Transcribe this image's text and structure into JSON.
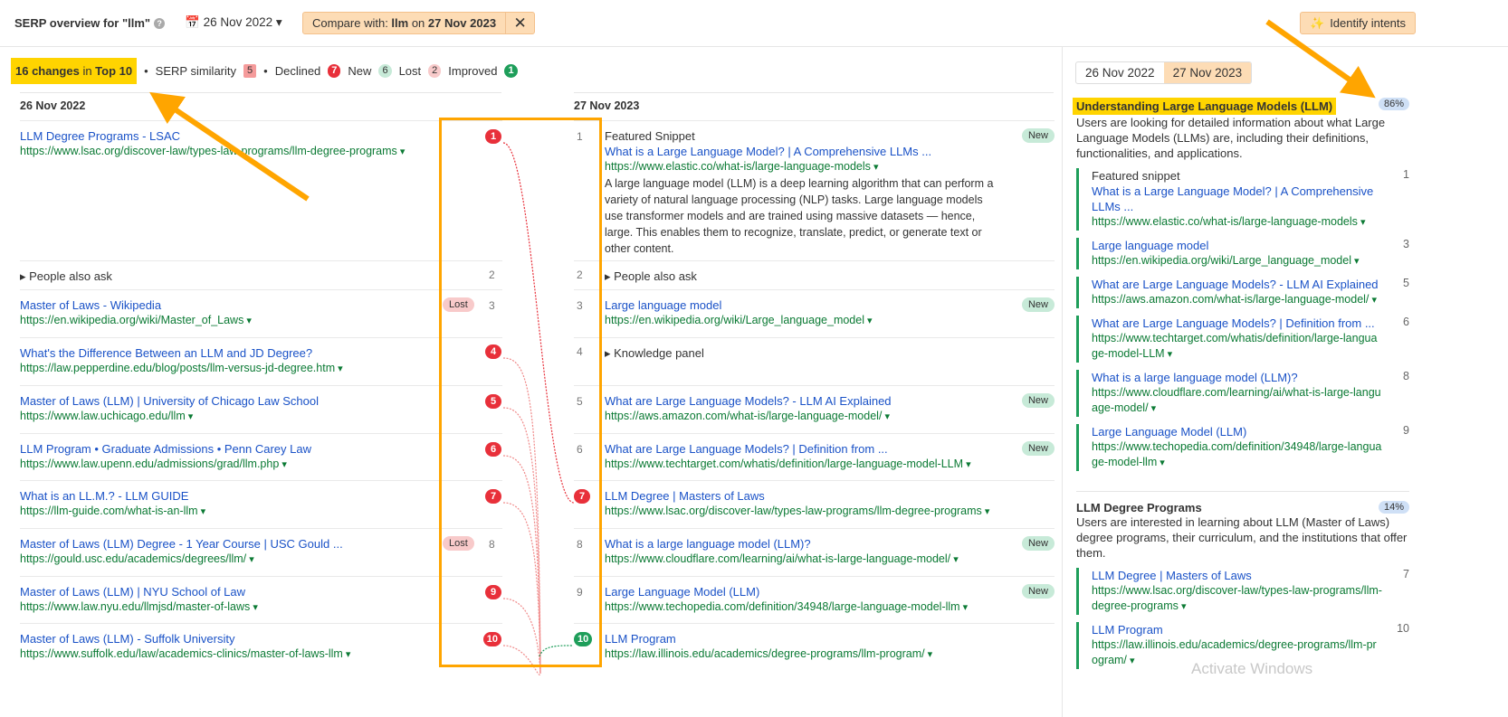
{
  "header": {
    "title": "SERP overview for \"llm\"",
    "date": "26 Nov 2022",
    "compare_prefix": "Compare with: ",
    "compare_kw": "llm",
    "compare_mid": " on ",
    "compare_date": "27 Nov 2023",
    "identify": "Identify intents"
  },
  "summary": {
    "changes": "16 changes",
    "in": " in ",
    "top": "Top 10",
    "similarity_label": "SERP similarity",
    "similarity": "5",
    "declined_label": "Declined",
    "declined": "7",
    "new_label": "New",
    "new": "6",
    "lost_label": "Lost",
    "lost": "2",
    "improved_label": "Improved",
    "improved": "1"
  },
  "colors": {
    "accent": "#ffa500",
    "declined": "#e8303a",
    "improved": "#1e9e5a",
    "highlight": "#ffd400"
  },
  "left": {
    "heading": "26 Nov 2022",
    "rows": [
      {
        "title": "LLM Degree Programs - LSAC",
        "url": "https://www.lsac.org/discover-law/types-law-programs/llm-degree-programs",
        "rank": "1",
        "kind": "declined"
      },
      {
        "serp": "People also ask",
        "rank": "2",
        "kind": "plain"
      },
      {
        "title": "Master of Laws - Wikipedia",
        "url": "https://en.wikipedia.org/wiki/Master_of_Laws",
        "rank": "3",
        "kind": "plain",
        "tag": "Lost"
      },
      {
        "title": "What's the Difference Between an LLM and JD Degree?",
        "url": "https://law.pepperdine.edu/blog/posts/llm-versus-jd-degree.htm",
        "rank": "4",
        "kind": "declined"
      },
      {
        "title": "Master of Laws (LLM) | University of Chicago Law School",
        "url": "https://www.law.uchicago.edu/llm",
        "rank": "5",
        "kind": "declined"
      },
      {
        "title": "LLM Program • Graduate Admissions • Penn Carey Law",
        "url": "https://www.law.upenn.edu/admissions/grad/llm.php",
        "rank": "6",
        "kind": "declined"
      },
      {
        "title": "What is an LL.M.? - LLM GUIDE",
        "url": "https://llm-guide.com/what-is-an-llm",
        "rank": "7",
        "kind": "declined"
      },
      {
        "title": "Master of Laws (LLM) Degree - 1 Year Course | USC Gould ...",
        "url": "https://gould.usc.edu/academics/degrees/llm/",
        "rank": "8",
        "kind": "plain",
        "tag": "Lost"
      },
      {
        "title": "Master of Laws (LLM) | NYU School of Law",
        "url": "https://www.law.nyu.edu/llmjsd/master-of-laws",
        "rank": "9",
        "kind": "declined"
      },
      {
        "title": "Master of Laws (LLM) - Suffolk University",
        "url": "https://www.suffolk.edu/law/academics-clinics/master-of-laws-llm",
        "rank": "10",
        "kind": "declined"
      }
    ]
  },
  "right": {
    "heading": "27 Nov 2023",
    "rows": [
      {
        "serp": "Featured Snippet",
        "title": "What is a Large Language Model? | A Comprehensive LLMs ...",
        "url": "https://www.elastic.co/what-is/large-language-models",
        "desc": "A large language model (LLM) is a deep learning algorithm that can perform a variety of natural language processing (NLP) tasks. Large language models use transformer models and are trained using massive datasets — hence, large. This enables them to recognize, translate, predict, or generate text or other content.",
        "rank": "1",
        "kind": "plain",
        "tag": "New"
      },
      {
        "serp": "People also ask",
        "rank": "2",
        "kind": "plain",
        "arrow": true
      },
      {
        "title": "Large language model",
        "url": "https://en.wikipedia.org/wiki/Large_language_model",
        "rank": "3",
        "kind": "plain",
        "tag": "New"
      },
      {
        "serp": "Knowledge panel",
        "rank": "4",
        "kind": "plain",
        "arrow": true
      },
      {
        "title": "What are Large Language Models? - LLM AI Explained",
        "url": "https://aws.amazon.com/what-is/large-language-model/",
        "rank": "5",
        "kind": "plain",
        "tag": "New"
      },
      {
        "title": "What are Large Language Models? | Definition from ...",
        "url": "https://www.techtarget.com/whatis/definition/large-language-model-LLM",
        "rank": "6",
        "kind": "plain",
        "tag": "New"
      },
      {
        "title": "LLM Degree | Masters of Laws",
        "url": "https://www.lsac.org/discover-law/types-law-programs/llm-degree-programs",
        "rank": "7",
        "kind": "declined"
      },
      {
        "title": "What is a large language model (LLM)?",
        "url": "https://www.cloudflare.com/learning/ai/what-is-large-language-model/",
        "rank": "8",
        "kind": "plain",
        "tag": "New"
      },
      {
        "title": "Large Language Model (LLM)",
        "url": "https://www.techopedia.com/definition/34948/large-language-model-llm",
        "rank": "9",
        "kind": "plain",
        "tag": "New"
      },
      {
        "title": "LLM Program",
        "url": "https://law.illinois.edu/academics/degree-programs/llm-program/",
        "rank": "10",
        "kind": "improved"
      }
    ]
  },
  "sidebar": {
    "tabs": [
      "26 Nov 2022",
      "27 Nov 2023"
    ],
    "active_tab": 1,
    "intents": [
      {
        "title": "Understanding Large Language Models (LLM)",
        "pct": "86%",
        "highlight": true,
        "desc": "Users are looking for detailed information about what Large Language Models (LLMs) are, including their definitions, functionalities, and applications.",
        "items": [
          {
            "serp": "Featured snippet",
            "title": "What is a Large Language Model? | A Comprehensive LLMs ...",
            "url": "https://www.elastic.co/what-is/large-language-models",
            "rank": "1"
          },
          {
            "title": "Large language model",
            "url": "https://en.wikipedia.org/wiki/Large_language_model",
            "rank": "3"
          },
          {
            "title": "What are Large Language Models? - LLM AI Explained",
            "url": "https://aws.amazon.com/what-is/large-language-model/",
            "rank": "5"
          },
          {
            "title": "What are Large Language Models? | Definition from ...",
            "url": "https://www.techtarget.com/whatis/definition/large-language-model-LLM",
            "rank": "6"
          },
          {
            "title": "What is a large language model (LLM)?",
            "url": "https://www.cloudflare.com/learning/ai/what-is-large-language-model/",
            "rank": "8"
          },
          {
            "title": "Large Language Model (LLM)",
            "url": "https://www.techopedia.com/definition/34948/large-language-model-llm",
            "rank": "9"
          }
        ]
      },
      {
        "title": "LLM Degree Programs",
        "pct": "14%",
        "highlight": false,
        "desc": "Users are interested in learning about LLM (Master of Laws) degree programs, their curriculum, and the institutions that offer them.",
        "items": [
          {
            "title": "LLM Degree | Masters of Laws",
            "url": "https://www.lsac.org/discover-law/types-law-programs/llm-degree-programs",
            "rank": "7"
          },
          {
            "title": "LLM Program",
            "url": "https://law.illinois.edu/academics/degree-programs/llm-program/",
            "rank": "10"
          }
        ]
      }
    ]
  },
  "watermark": "Activate Windows"
}
